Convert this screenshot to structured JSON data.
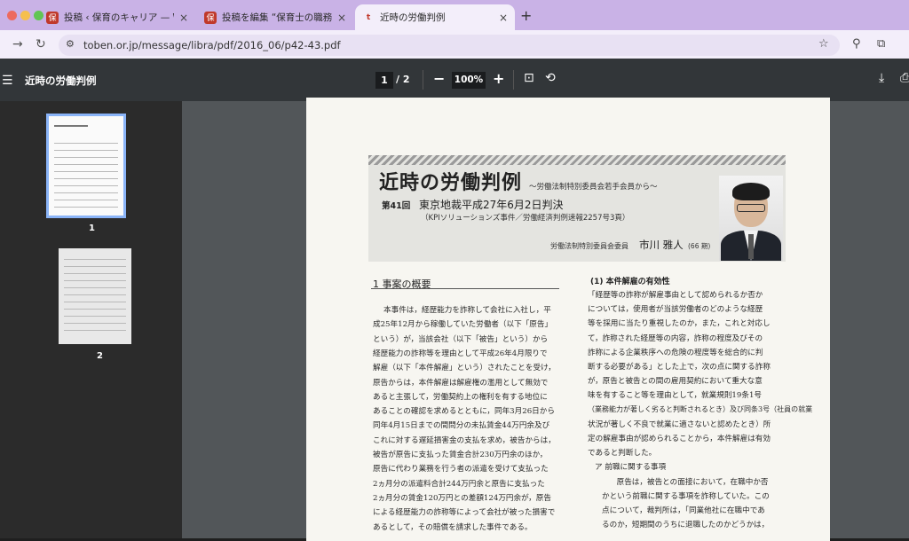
{
  "browser": {
    "tabs": [
      {
        "title": "投稿 ‹ 保育のキャリア — WordPress",
        "favicon": "保",
        "favicon_color": "#c0392b"
      },
      {
        "title": "投稿を編集 “保育士の職務経歴書",
        "favicon": "保",
        "favicon_color": "#c0392b"
      },
      {
        "title": "近時の労働判例",
        "favicon": "t",
        "favicon_color": "#f3eefa"
      }
    ],
    "close_glyph": "×",
    "new_tab_glyph": "+",
    "url": "toben.or.jp/message/libra/pdf/2016_06/p42-43.pdf",
    "icons": [
      "back-icon",
      "reload-icon",
      "site-info-icon",
      "bookmark-star-icon",
      "extensions-icon",
      "puzzle-icon"
    ]
  },
  "pdf": {
    "title": "近時の労働判例",
    "current_page": "1",
    "page_separator": "/",
    "total_pages": "2",
    "zoom": "100%",
    "zoom_out": "−",
    "zoom_in": "+",
    "thumbnails": [
      {
        "label": "1"
      },
      {
        "label": "2"
      }
    ]
  },
  "document": {
    "title": "近時の労働判例",
    "subtitle": "〜労働法制特別委員会若手会員から〜",
    "case_number": "第41回",
    "case_title": "東京地裁平成27年6月2日判決",
    "case_info": "（KPIソリューションズ事件／労働経済判例速報2257号3頁）",
    "author_role": "労働法制特別委員会委員",
    "author_name": "市川 雅人",
    "author_term": "(66 期)",
    "section1": "1 事案の概要",
    "left_lines": [
      "本事件は，経歴能力を詐称して会社に入社し，平",
      "成25年12月から稼働していた労働者（以下「原告」",
      "という）が，当該会社（以下「被告」という）から",
      "経歴能力の詐称等を理由として平成26年4月限りで",
      "解雇（以下「本件解雇」という）されたことを受け，",
      "原告からは，本件解雇は解雇権の濫用として無効で",
      "あると主張して，労働契約上の権利を有する地位に",
      "あることの確認を求めるとともに，同年3月26日から",
      "同年4月15日までの間問分の未払賃金44万円余及び",
      "これに対する遅延損害金の支払を求め，被告からは，",
      "被告が原告に支払った賃金合計230万円余のほか，",
      "原告に代わり業務を行う者の派遣を受けて支払った",
      "2ヵ月分の派遣料合計244万円余と原告に支払った",
      "2ヵ月分の賃金120万円との差額124万円余が，原告",
      "による経歴能力の詐称等によって会社が被った損害で",
      "あるとして，その賠償を請求した事件である。"
    ],
    "right_heading": "(1) 本件解雇の有効性",
    "right_lines": [
      "「経歴等の詐称が解雇事由として認められるか否か",
      "については，使用者が当該労働者のどのような経歴",
      "等を採用に当たり重視したのか，また，これと対応し",
      "て，詐称された経歴等の内容，詐称の程度及びその",
      "詐称による企業秩序への危険の程度等を総合的に判",
      "断する必要がある」とした上で，次の点に関する詐称",
      "が，原告と被告との間の雇用契約において重大な意",
      "味を有すること等を理由として，就業規則19条1号",
      "（業務能力が著しく劣ると判断されるとき）及び同条3号（社員の就業",
      "状況が著しく不良で就業に適さないと認めたとき）所",
      "定の解雇事由が認められることから，本件解雇は有効",
      "であると判断した。",
      "ア 前職に関する事項",
      "　原告は，被告との面接において，在職中か否",
      "かという前職に関する事項を詐称していた。この",
      "点について，裁判所は，「同業他社に在職中であ",
      "るのか，短期間のうちに退職したのかどうかは，"
    ]
  }
}
